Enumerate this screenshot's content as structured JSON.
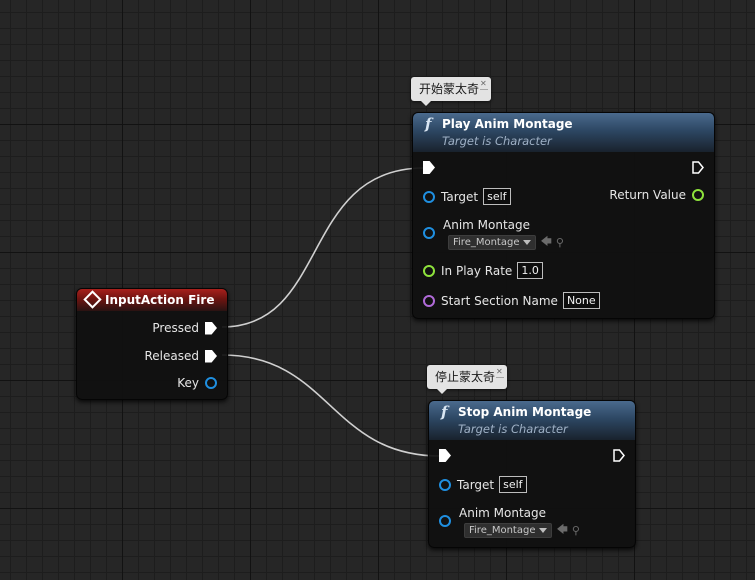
{
  "comments": {
    "play": "开始蒙太奇",
    "stop": "停止蒙太奇"
  },
  "input_node": {
    "title": "InputAction Fire",
    "pins": {
      "pressed": "Pressed",
      "released": "Released",
      "key": "Key"
    }
  },
  "play_node": {
    "icon": "f",
    "title": "Play Anim Montage",
    "subtitle": "Target is Character",
    "target_label": "Target",
    "target_value": "self",
    "return_label": "Return Value",
    "montage_label": "Anim Montage",
    "montage_value": "Fire_Montage",
    "rate_label": "In Play Rate",
    "rate_value": "1.0",
    "section_label": "Start Section Name",
    "section_value": "None"
  },
  "stop_node": {
    "icon": "f",
    "title": "Stop Anim Montage",
    "subtitle": "Target is Character",
    "target_label": "Target",
    "target_value": "self",
    "montage_label": "Anim Montage",
    "montage_value": "Fire_Montage"
  },
  "colors": {
    "event_header": "#a8201c",
    "function_header": "#4a6a8d",
    "object_pin": "#1f8fe0",
    "float_pin": "#8ee23c",
    "name_pin": "#b06ad8",
    "exec_wire": "#d8d8d8"
  }
}
